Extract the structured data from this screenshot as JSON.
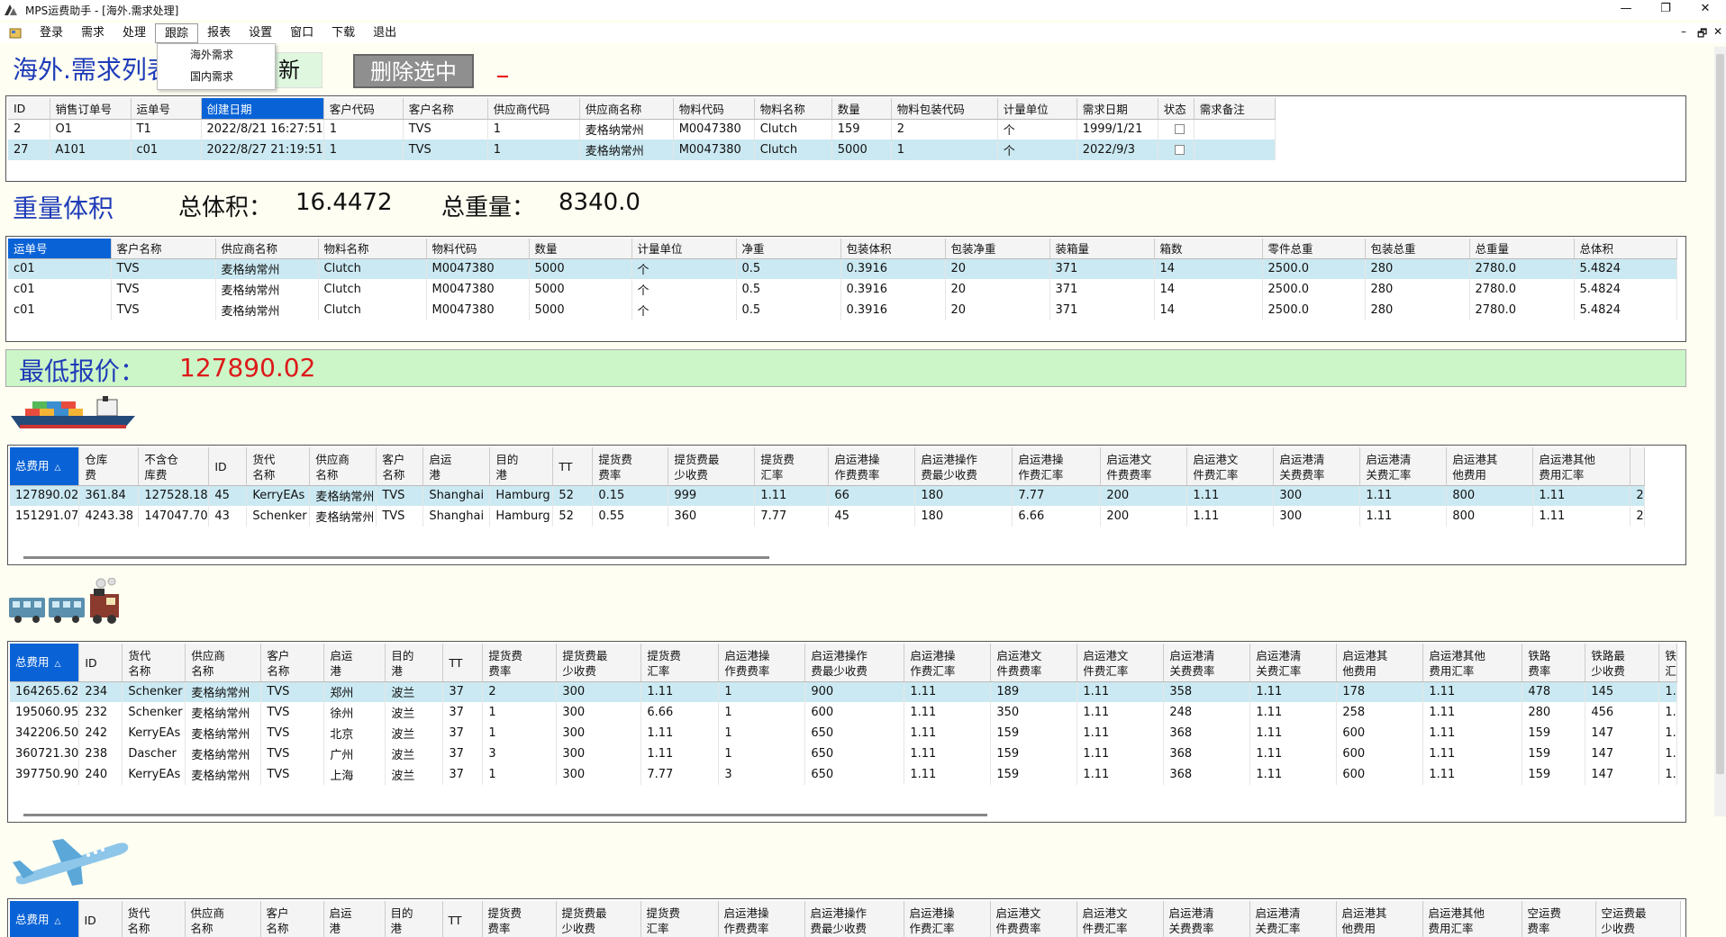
{
  "window": {
    "title": "MPS运费助手 - [海外.需求处理]",
    "controls": [
      "—",
      "❐",
      "✕"
    ],
    "mdi_controls": [
      "–",
      "🗗",
      "✕"
    ]
  },
  "menu": {
    "items": [
      "登录",
      "需求",
      "处理",
      "跟踪",
      "报表",
      "设置",
      "窗口",
      "下载",
      "退出"
    ],
    "open_index": 3,
    "dropdown": [
      "海外需求",
      "国内需求"
    ]
  },
  "header": {
    "title": "海外.需求列表",
    "refresh_label": "新",
    "delete_label": "删除选中"
  },
  "demand_table": {
    "columns": [
      "ID",
      "销售订单号",
      "运单号",
      "创建日期",
      "客户代码",
      "客户名称",
      "供应商代码",
      "供应商名称",
      "物料代码",
      "物料名称",
      "数量",
      "物料包装代码",
      "计量单位",
      "需求日期",
      "状态",
      "需求备注"
    ],
    "rows": [
      [
        "2",
        "O1",
        "T1",
        "2022/8/21 16:27:51",
        "1",
        "TVS",
        "1",
        "麦格纳常州",
        "M0047380",
        "Clutch",
        "159",
        "2",
        "个",
        "1999/1/21",
        "",
        ""
      ],
      [
        "27",
        "A101",
        "c01",
        "2022/8/27 21:19:51",
        "1",
        "TVS",
        "1",
        "麦格纳常州",
        "M0047380",
        "Clutch",
        "5000",
        "1",
        "个",
        "2022/9/3",
        "",
        ""
      ]
    ]
  },
  "weight_volume": {
    "title": "重量体积",
    "total_volume_label": "总体积：",
    "total_volume": "16.4472",
    "total_weight_label": "总重量：",
    "total_weight": "8340.0"
  },
  "weight_table": {
    "columns": [
      "运单号",
      "客户名称",
      "供应商名称",
      "物料名称",
      "物料代码",
      "数量",
      "计量单位",
      "净重",
      "包装体积",
      "包装净重",
      "装箱量",
      "箱数",
      "零件总重",
      "包装总重",
      "总重量",
      "总体积"
    ],
    "rows": [
      [
        "c01",
        "TVS",
        "麦格纳常州",
        "Clutch",
        "M0047380",
        "5000",
        "个",
        "0.5",
        "0.3916",
        "20",
        "371",
        "14",
        "2500.0",
        "280",
        "2780.0",
        "5.4824"
      ],
      [
        "c01",
        "TVS",
        "麦格纳常州",
        "Clutch",
        "M0047380",
        "5000",
        "个",
        "0.5",
        "0.3916",
        "20",
        "371",
        "14",
        "2500.0",
        "280",
        "2780.0",
        "5.4824"
      ],
      [
        "c01",
        "TVS",
        "麦格纳常州",
        "Clutch",
        "M0047380",
        "5000",
        "个",
        "0.5",
        "0.3916",
        "20",
        "371",
        "14",
        "2500.0",
        "280",
        "2780.0",
        "5.4824"
      ]
    ]
  },
  "min_price": {
    "label": "最低报价：",
    "value": "127890.02"
  },
  "sea_table": {
    "columns": [
      "总费用",
      "仓库\n费",
      "不含仓\n库费",
      "ID",
      "货代\n名称",
      "供应商\n名称",
      "客户\n名称",
      "启运\n港",
      "目的\n港",
      "TT",
      "提货费\n费率",
      "提货费最\n少收费",
      "提货费\n汇率",
      "启运港操\n作费费率",
      "启运港操作\n费最少收费",
      "启运港操\n作费汇率",
      "启运港文\n件费费率",
      "启运港文\n件费汇率",
      "启运港清\n关费费率",
      "启运港清\n关费汇率",
      "启运港其\n他费用",
      "启运港其他\n费用汇率",
      ""
    ],
    "rows": [
      [
        "127890.02",
        "361.84",
        "127528.18",
        "45",
        "KerryEAs",
        "麦格纳常州",
        "TVS",
        "Shanghai",
        "Hamburg",
        "52",
        "0.15",
        "999",
        "1.11",
        "66",
        "180",
        "7.77",
        "200",
        "1.11",
        "300",
        "1.11",
        "800",
        "1.11",
        "2"
      ],
      [
        "151291.07",
        "4243.38",
        "147047.70",
        "43",
        "Schenker",
        "麦格纳常州",
        "TVS",
        "Shanghai",
        "Hamburg",
        "52",
        "0.55",
        "360",
        "7.77",
        "45",
        "180",
        "6.66",
        "200",
        "1.11",
        "300",
        "1.11",
        "800",
        "1.11",
        "2"
      ]
    ]
  },
  "rail_table": {
    "columns": [
      "总费用",
      "ID",
      "货代\n名称",
      "供应商\n名称",
      "客户\n名称",
      "启运\n港",
      "目的\n港",
      "TT",
      "提货费\n费率",
      "提货费最\n少收费",
      "提货费\n汇率",
      "启运港操\n作费费率",
      "启运港操作\n费最少收费",
      "启运港操\n作费汇率",
      "启运港文\n件费费率",
      "启运港文\n件费汇率",
      "启运港清\n关费费率",
      "启运港清\n关费汇率",
      "启运港其\n他费用",
      "启运港其他\n费用汇率",
      "铁路\n费率",
      "铁路最\n少收费",
      "铁\n汇"
    ],
    "rows": [
      [
        "164265.62",
        "234",
        "Schenker",
        "麦格纳常州",
        "TVS",
        "郑州",
        "波兰",
        "37",
        "2",
        "300",
        "1.11",
        "1",
        "900",
        "1.11",
        "189",
        "1.11",
        "358",
        "1.11",
        "178",
        "1.11",
        "478",
        "145",
        "1."
      ],
      [
        "195060.95",
        "232",
        "Schenker",
        "麦格纳常州",
        "TVS",
        "徐州",
        "波兰",
        "37",
        "1",
        "300",
        "6.66",
        "1",
        "600",
        "1.11",
        "350",
        "1.11",
        "248",
        "1.11",
        "258",
        "1.11",
        "280",
        "456",
        "1."
      ],
      [
        "342206.50",
        "242",
        "KerryEAs",
        "麦格纳常州",
        "TVS",
        "北京",
        "波兰",
        "37",
        "1",
        "300",
        "1.11",
        "1",
        "650",
        "1.11",
        "159",
        "1.11",
        "368",
        "1.11",
        "600",
        "1.11",
        "159",
        "147",
        "1."
      ],
      [
        "360721.30",
        "238",
        "Dascher",
        "麦格纳常州",
        "TVS",
        "广州",
        "波兰",
        "37",
        "3",
        "300",
        "1.11",
        "1",
        "650",
        "1.11",
        "159",
        "1.11",
        "368",
        "1.11",
        "600",
        "1.11",
        "159",
        "147",
        "1."
      ],
      [
        "397750.90",
        "240",
        "KerryEAs",
        "麦格纳常州",
        "TVS",
        "上海",
        "波兰",
        "37",
        "1",
        "300",
        "7.77",
        "3",
        "650",
        "1.11",
        "159",
        "1.11",
        "368",
        "1.11",
        "600",
        "1.11",
        "159",
        "147",
        "1."
      ]
    ]
  },
  "air_table": {
    "columns": [
      "总费用",
      "ID",
      "货代\n名称",
      "供应商\n名称",
      "客户\n名称",
      "启运\n港",
      "目的\n港",
      "TT",
      "提货费\n费率",
      "提货费最\n少收费",
      "提货费\n汇率",
      "启运港操\n作费费率",
      "启运港操作\n费最少收费",
      "启运港操\n作费汇率",
      "启运港文\n件费费率",
      "启运港文\n件费汇率",
      "启运港清\n关费费率",
      "启运港清\n关费汇率",
      "启运港其\n他费用",
      "启运港其他\n费用汇率",
      "空运费\n费率",
      "空运费最\n少收费"
    ]
  },
  "icons": [
    "ship-icon",
    "train-icon",
    "airplane-icon"
  ],
  "colors": {
    "accent": "#0a63d6",
    "title_blue": "#1e3bb8",
    "price_red": "#dd1a1a",
    "price_bg": "#ccf6c8",
    "selected_row": "#cbe9f2"
  }
}
